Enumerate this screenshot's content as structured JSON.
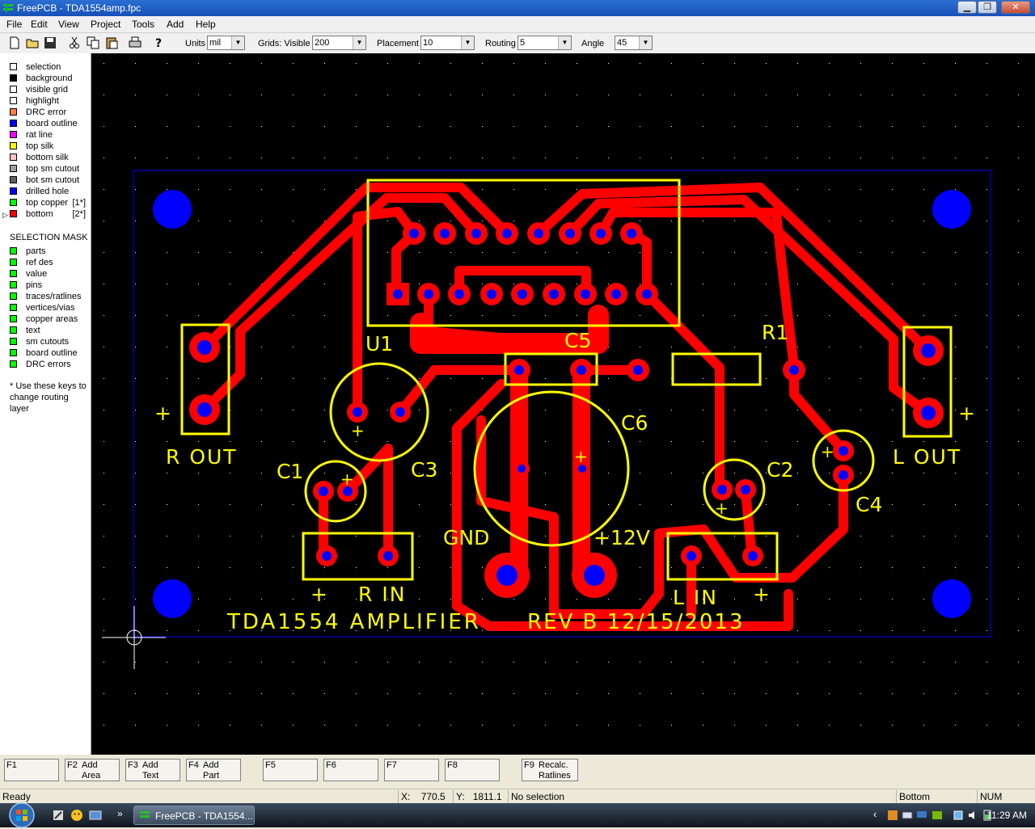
{
  "window": {
    "title": "FreePCB - TDA1554amp.fpc",
    "minimize": "▁",
    "maximize": "❐",
    "close": "✕"
  },
  "menu": [
    "File",
    "Edit",
    "View",
    "Project",
    "Tools",
    "Add",
    "Help"
  ],
  "toolbar": {
    "units_label": "Units",
    "units_value": "mil",
    "grids_label": "Grids: Visible",
    "grids_value": "200",
    "placement_label": "Placement",
    "placement_value": "10",
    "routing_label": "Routing",
    "routing_value": "5",
    "angle_label": "Angle",
    "angle_value": "45",
    "icons": [
      "new-file-icon",
      "open-folder-icon",
      "save-icon",
      "cut-icon",
      "copy-icon",
      "paste-icon",
      "print-icon",
      "help-icon"
    ]
  },
  "layers": [
    {
      "label": "selection",
      "color": "#ffffff",
      "key": ""
    },
    {
      "label": "background",
      "color": "#000000",
      "key": ""
    },
    {
      "label": "visible grid",
      "color": "#ffffff",
      "key": ""
    },
    {
      "label": "highlight",
      "color": "#ffffff",
      "key": ""
    },
    {
      "label": "DRC error",
      "color": "#ff8040",
      "key": ""
    },
    {
      "label": "board outline",
      "color": "#0000ff",
      "key": ""
    },
    {
      "label": "rat line",
      "color": "#ff00ff",
      "key": ""
    },
    {
      "label": "top silk",
      "color": "#ffff00",
      "key": ""
    },
    {
      "label": "bottom silk",
      "color": "#ffc0c0",
      "key": ""
    },
    {
      "label": "top sm cutout",
      "color": "#a0a0a0",
      "key": ""
    },
    {
      "label": "bot sm cutout",
      "color": "#606060",
      "key": ""
    },
    {
      "label": "drilled hole",
      "color": "#0000ff",
      "key": ""
    },
    {
      "label": "top copper",
      "color": "#00ff00",
      "key": "[1*]"
    },
    {
      "label": "bottom",
      "color": "#ff0000",
      "key": "[2*]"
    }
  ],
  "active_layer_marker": "▷",
  "selection_mask": {
    "title": "SELECTION MASK",
    "items": [
      "parts",
      "ref des",
      "value",
      "pins",
      "traces/ratlines",
      "vertices/vias",
      "copper areas",
      "text",
      "sm cutouts",
      "board outline",
      "DRC errors"
    ],
    "color": "#00ff00"
  },
  "note": "* Use these keys to change routing layer",
  "board": {
    "labels": {
      "u1": "U1",
      "c5": "C5",
      "r1": "R1",
      "c6": "C6",
      "c1": "C1",
      "c3": "C3",
      "c2": "C2",
      "c4": "C4",
      "rout": "R  OUT",
      "lout": "L  OUT",
      "gnd": "GND",
      "v12": "+12V",
      "rin": "R  IN",
      "lin": "L  IN",
      "title": "TDA1554  AMPLIFIER",
      "rev": "REV B 12/15/2013",
      "plus": "+"
    },
    "colors": {
      "copper": "#ff0000",
      "silk": "#ffff00",
      "hole": "#0000ff",
      "outline": "#0000ff",
      "grid": "#ffffff"
    }
  },
  "fkeys": [
    {
      "key": "F1",
      "label": ""
    },
    {
      "key": "F2",
      "label": "Add\nArea"
    },
    {
      "key": "F3",
      "label": "Add\nText"
    },
    {
      "key": "F4",
      "label": "Add\nPart"
    },
    {
      "key": "F5",
      "label": ""
    },
    {
      "key": "F6",
      "label": ""
    },
    {
      "key": "F7",
      "label": ""
    },
    {
      "key": "F8",
      "label": ""
    },
    {
      "key": "F9",
      "label": "Recalc.\nRatlines"
    }
  ],
  "status": {
    "ready": "Ready",
    "x_label": "X:",
    "x_value": "770.5",
    "y_label": "Y:",
    "y_value": "1811.1",
    "selection": "No selection",
    "layer": "Bottom",
    "num": "NUM"
  },
  "taskbar": {
    "task": "FreePCB - TDA1554...",
    "time": "11:29 AM",
    "overflow": "»",
    "tray_arrow": "‹"
  }
}
